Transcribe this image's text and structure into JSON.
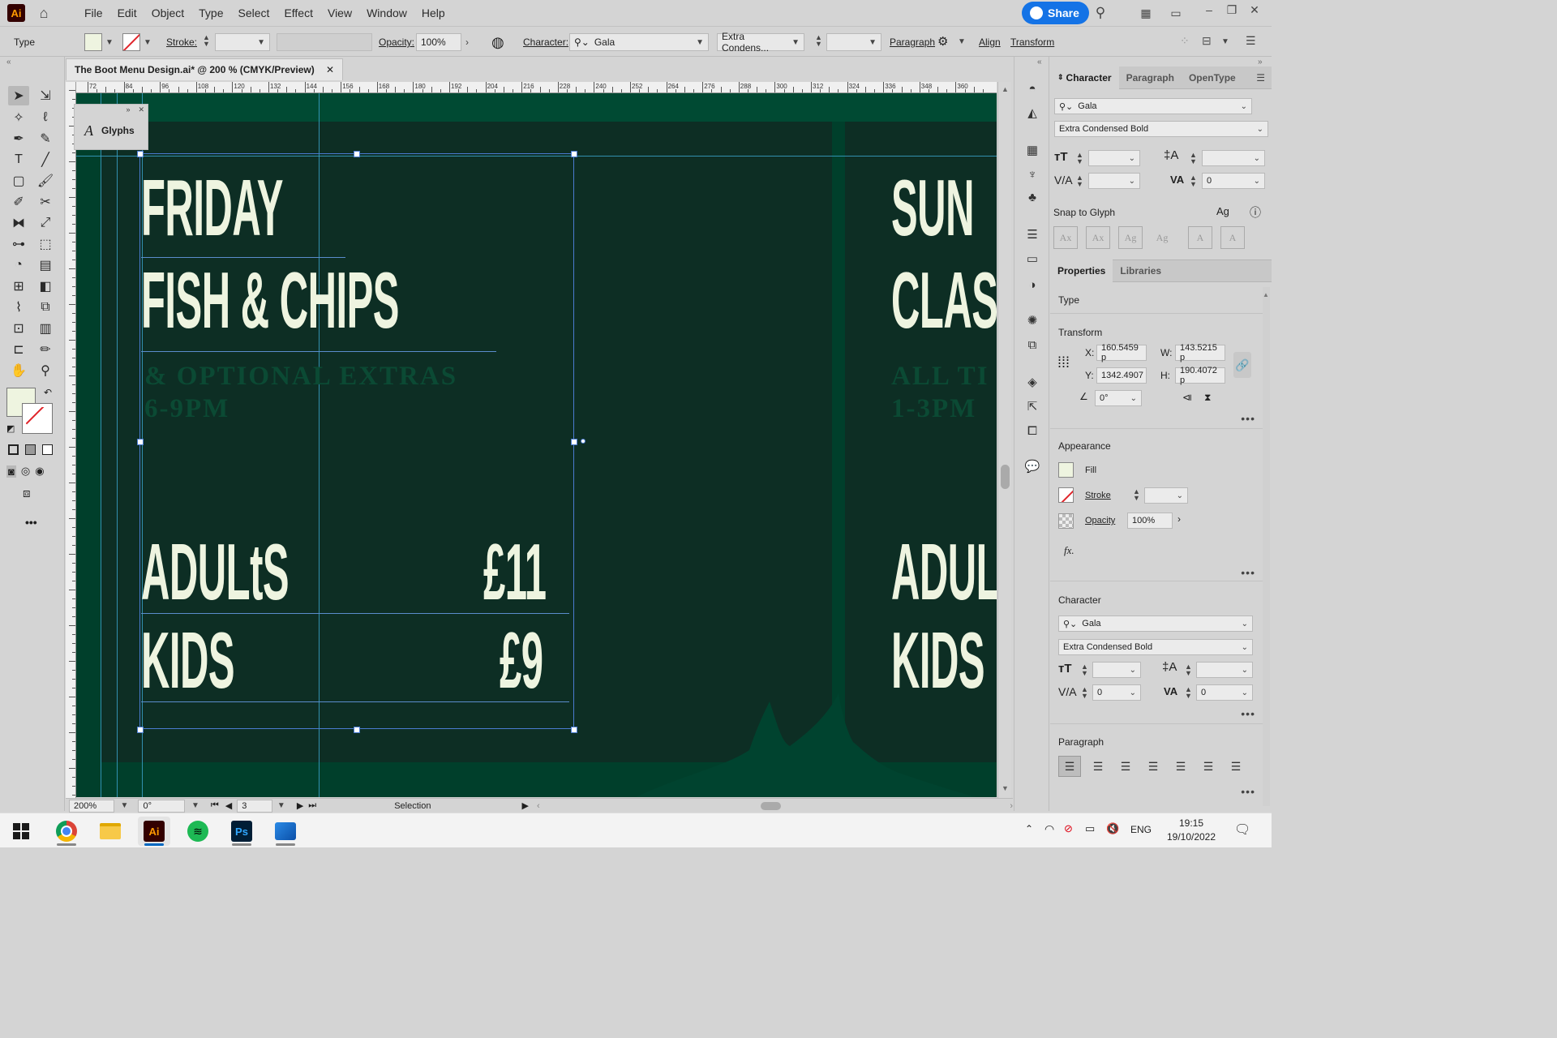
{
  "menubar": {
    "app_logo": "Ai",
    "items": [
      "File",
      "Edit",
      "Object",
      "Type",
      "Select",
      "Effect",
      "View",
      "Window",
      "Help"
    ],
    "share_label": "Share"
  },
  "control_bar": {
    "mode": "Type",
    "stroke_label": "Stroke:",
    "opacity_label": "Opacity:",
    "opacity_value": "100%",
    "character_label": "Character:",
    "font_name": "Gala",
    "font_style": "Extra Condens...",
    "paragraph_label": "Paragraph",
    "align_label": "Align",
    "transform_label": "Transform"
  },
  "document": {
    "tab_title": "The Boot Menu Design.ai* @ 200 % (CMYK/Preview)",
    "ruler_ticks": [
      "72",
      "84",
      "96",
      "108",
      "120",
      "132",
      "144",
      "156",
      "168",
      "180",
      "192",
      "204",
      "216",
      "228",
      "240",
      "252",
      "264",
      "276",
      "288",
      "300",
      "312",
      "324",
      "336",
      "348",
      "360"
    ]
  },
  "glyphs_panel": {
    "label": "Glyphs"
  },
  "artwork": {
    "left_heading_1": "FRIDAY",
    "left_heading_2": "FISH & CHIPS",
    "left_sub_1": "& OPTIONAL EXTRAS",
    "left_sub_2": "6-9PM",
    "adults_label": "ADULtS",
    "adults_price": "£11",
    "kids_label": "KIDS",
    "kids_price": "£9",
    "right_heading_1": "SUN",
    "right_heading_2": "CLAS",
    "right_sub_1": "ALL TI",
    "right_sub_2": "1-3PM",
    "right_adults": "ADUL",
    "right_kids": "KIDS",
    "colors": {
      "bg_dark": "#0d2e24",
      "bg_green": "#003f2b",
      "text_cream": "#eef4e0",
      "sub_green": "#0b4a34"
    }
  },
  "status_bar": {
    "zoom": "200%",
    "rotation": "0°",
    "artboard": "3",
    "tool_name": "Selection"
  },
  "character_panel": {
    "tabs": [
      "Character",
      "Paragraph",
      "OpenType"
    ],
    "font_name": "Gala",
    "font_style": "Extra Condensed Bold",
    "tracking_value": "0",
    "snap_label": "Snap to Glyph"
  },
  "properties_panel": {
    "tabs": [
      "Properties",
      "Libraries"
    ],
    "type_label": "Type",
    "transform_title": "Transform",
    "x_label": "X:",
    "x_value": "160.5459 p",
    "y_label": "Y:",
    "y_value": "1342.4907",
    "w_label": "W:",
    "w_value": "143.5215 p",
    "h_label": "H:",
    "h_value": "190.4072 p",
    "angle_value": "0°",
    "appearance_title": "Appearance",
    "fill_label": "Fill",
    "stroke_label": "Stroke",
    "opacity_label": "Opacity",
    "opacity_value": "100%",
    "fx_label": "fx.",
    "character_title": "Character",
    "char_font_name": "Gala",
    "char_font_style": "Extra Condensed Bold",
    "char_tracking_1": "0",
    "char_tracking_2": "0",
    "paragraph_title": "Paragraph"
  },
  "taskbar": {
    "language": "ENG",
    "time": "19:15",
    "date": "19/10/2022"
  }
}
